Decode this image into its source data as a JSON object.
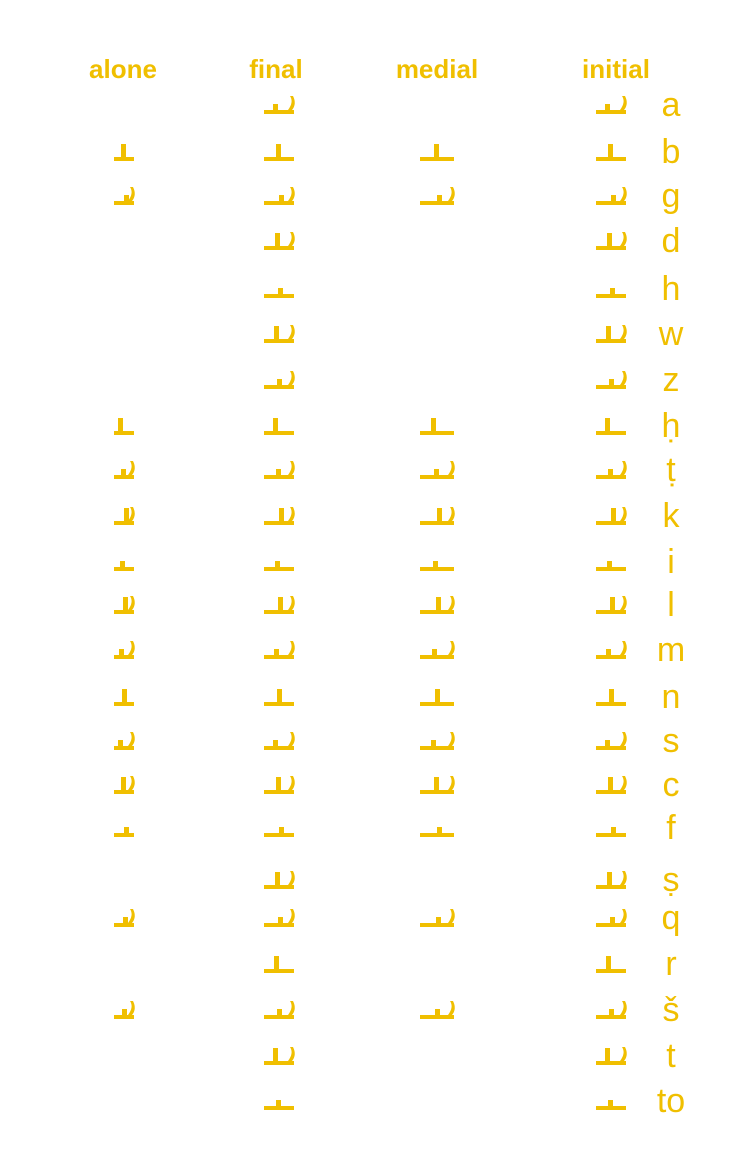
{
  "headers": {
    "alone": "alone",
    "final": "final",
    "medial": "medial",
    "initial": "initial"
  },
  "letter_color": "#f0bf00",
  "letters": [
    {
      "latin": "a",
      "forms": [
        "final",
        "initial"
      ]
    },
    {
      "latin": "b",
      "forms": [
        "alone",
        "final",
        "medial",
        "initial"
      ]
    },
    {
      "latin": "g",
      "forms": [
        "alone",
        "final",
        "medial",
        "initial"
      ]
    },
    {
      "latin": "d",
      "forms": [
        "final",
        "initial"
      ]
    },
    {
      "latin": "h",
      "forms": [
        "final",
        "initial"
      ]
    },
    {
      "latin": "w",
      "forms": [
        "final",
        "initial"
      ]
    },
    {
      "latin": "z",
      "forms": [
        "final",
        "initial"
      ]
    },
    {
      "latin": "ḥ",
      "forms": [
        "alone",
        "final",
        "medial",
        "initial"
      ]
    },
    {
      "latin": "ṭ",
      "forms": [
        "alone",
        "final",
        "medial",
        "initial"
      ]
    },
    {
      "latin": "k",
      "forms": [
        "alone",
        "final",
        "medial",
        "initial"
      ]
    },
    {
      "latin": "i",
      "forms": [
        "alone",
        "final",
        "medial",
        "initial"
      ]
    },
    {
      "latin": "l",
      "forms": [
        "alone",
        "final",
        "medial",
        "initial"
      ]
    },
    {
      "latin": "m",
      "forms": [
        "alone",
        "final",
        "medial",
        "initial"
      ]
    },
    {
      "latin": "n",
      "forms": [
        "alone",
        "final",
        "medial",
        "initial"
      ]
    },
    {
      "latin": "s",
      "forms": [
        "alone",
        "final",
        "medial",
        "initial"
      ]
    },
    {
      "latin": "c",
      "forms": [
        "alone",
        "final",
        "medial",
        "initial"
      ]
    },
    {
      "latin": "f",
      "forms": [
        "alone",
        "final",
        "medial",
        "initial"
      ]
    },
    {
      "latin": "ṣ",
      "forms": [
        "final",
        "initial"
      ]
    },
    {
      "latin": "q",
      "forms": [
        "alone",
        "final",
        "medial",
        "initial"
      ]
    },
    {
      "latin": "r",
      "forms": [
        "final",
        "initial"
      ]
    },
    {
      "latin": "š",
      "forms": [
        "alone",
        "final",
        "medial",
        "initial"
      ]
    },
    {
      "latin": "t",
      "forms": [
        "final",
        "initial"
      ]
    },
    {
      "latin": "to",
      "forms": [
        "final",
        "initial"
      ]
    }
  ]
}
